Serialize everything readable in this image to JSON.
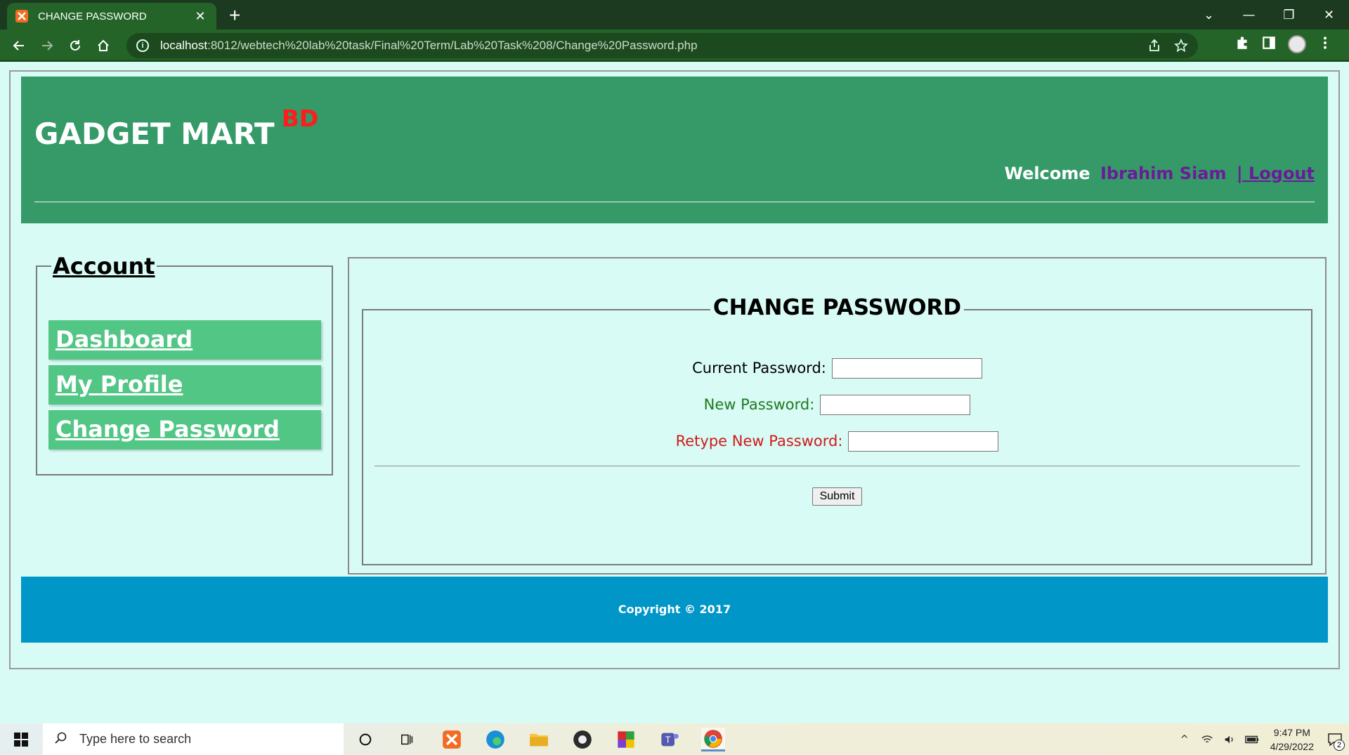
{
  "browser": {
    "tab_title": "CHANGE PASSWORD",
    "url_host": "localhost",
    "url_rest": ":8012/webtech%20lab%20task/Final%20Term/Lab%20Task%208/Change%20Password.php"
  },
  "header": {
    "brand": "GADGET MART",
    "brand_sup": "BD",
    "welcome_label": "Welcome",
    "user_name": "Ibrahim Siam",
    "logout": "| Logout"
  },
  "sidebar": {
    "legend": "Account",
    "items": [
      {
        "label": "Dashboard"
      },
      {
        "label": "My Profile"
      },
      {
        "label": "Change Password"
      }
    ]
  },
  "form": {
    "legend": "CHANGE PASSWORD",
    "current_label": "Current Password:",
    "new_label": "New Password:",
    "retype_label": "Retype New Password:",
    "submit": "Submit"
  },
  "footer": {
    "text": "Copyright © 2017"
  },
  "taskbar": {
    "search_placeholder": "Type here to search",
    "time": "9:47 PM",
    "date": "4/29/2022",
    "notification_count": "2"
  },
  "colors": {
    "header_bg": "#359a67",
    "menu_bg": "#52c685",
    "footer_bg": "#0096c8",
    "page_bg": "#d8fbf5",
    "brand_sup": "#ff1c1c",
    "user_name": "#6b1b9a",
    "new_label": "#1f7a1f",
    "retype_label": "#d11a1a"
  },
  "icons": [
    "xampp-icon",
    "close-icon",
    "plus-icon",
    "back-arrow-icon",
    "forward-arrow-icon",
    "reload-icon",
    "home-icon",
    "info-icon",
    "share-icon",
    "star-icon",
    "puzzle-icon",
    "sidebar-icon",
    "kebab-menu-icon",
    "windows-icon",
    "search-icon",
    "cortana-icon",
    "task-view-icon",
    "edge-icon",
    "file-explorer-icon",
    "obs-icon",
    "teams-icon",
    "chrome-icon"
  ]
}
